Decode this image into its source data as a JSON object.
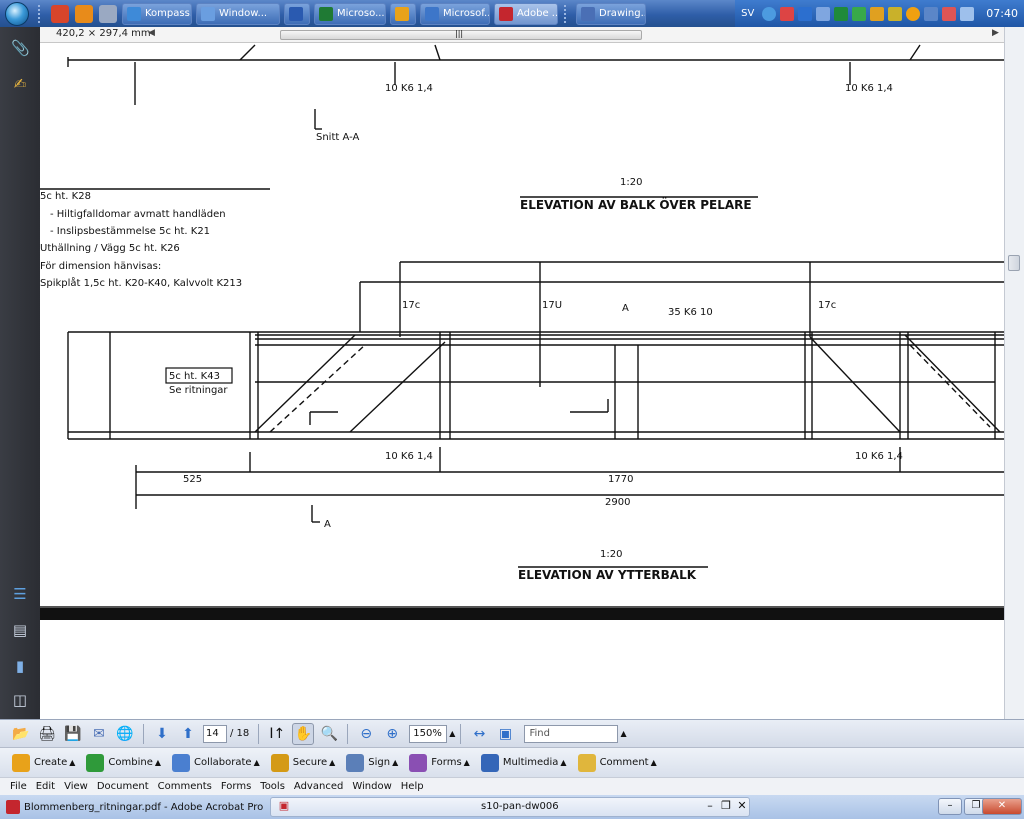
{
  "taskbar": {
    "tasks": [
      {
        "label": "Kompass...",
        "color": "#3e8ad8",
        "active": false
      },
      {
        "label": "Window...",
        "color": "#6a9ee0",
        "active": false
      },
      {
        "label": "W",
        "color": "#2a5ab0",
        "active": false
      },
      {
        "label": "Microso...",
        "color": "#1f7a34",
        "active": false
      },
      {
        "label": "O",
        "color": "#e8a21a",
        "active": false
      },
      {
        "label": "Microsof...",
        "color": "#3d76c9",
        "active": false
      },
      {
        "label": "Adobe ...",
        "color": "#c4262e",
        "active": true
      },
      {
        "label": "Drawing...",
        "color": "#4a6fb5",
        "active": false
      }
    ],
    "lang": "SV",
    "clock": "07:40"
  },
  "document": {
    "page_size": "420,2 × 297,4 mm",
    "ruler_center": "|||",
    "labels": {
      "dim_a": "10 K6 1,4",
      "dim_b": "10 K6 1,4",
      "snitt": "Snitt A-A",
      "scale_1": "1:20",
      "elevation_1": "ELEVATION AV BALK ÖVER PELARE",
      "notes": [
        "Spikplåt 1,5c ht. K20-K40, Kalvvolt K213",
        "För dimension hänvisas:",
        "Uthällning / Vägg 5c ht. K26",
        "- Inslipsbestämmelse 5c ht. K21",
        "- Hiltigfalldomar avmatt handläden",
        "5c ht. K28"
      ],
      "box_label": "5c ht. K43",
      "box_sub": "Se ritningar",
      "tags": [
        "17c",
        "17U",
        "17c",
        "35 K6 10",
        "A"
      ],
      "dim_row1": [
        "10 K6 1,4",
        "10 K6 1,4"
      ],
      "dim_row2": [
        "525",
        "1770"
      ],
      "dim_row3": "2900",
      "section_mark": "A",
      "scale_2": "1:20",
      "elevation_2": "ELEVATION AV YTTERBALK"
    }
  },
  "nav_toolbar": {
    "page_current": "14",
    "page_total": "/ 18",
    "zoom": "150%",
    "find_placeholder": "Find"
  },
  "task_toolbar": {
    "items": [
      {
        "label": "Create",
        "color": "#e8a21a"
      },
      {
        "label": "Combine",
        "color": "#2f9a3a"
      },
      {
        "label": "Collaborate",
        "color": "#4a7fd0"
      },
      {
        "label": "Secure",
        "color": "#d49a16"
      },
      {
        "label": "Sign",
        "color": "#5b7fb8"
      },
      {
        "label": "Forms",
        "color": "#8a4fb3"
      },
      {
        "label": "Multimedia",
        "color": "#3466b8"
      },
      {
        "label": "Comment",
        "color": "#e0b63c"
      }
    ]
  },
  "menubar": {
    "items": [
      "File",
      "Edit",
      "View",
      "Document",
      "Comments",
      "Forms",
      "Tools",
      "Advanced",
      "Window",
      "Help"
    ]
  },
  "titlebar": {
    "title": "Blommenberg_ritningar.pdf - Adobe Acrobat Pro",
    "doc_tab": "s10-pan-dw006"
  }
}
